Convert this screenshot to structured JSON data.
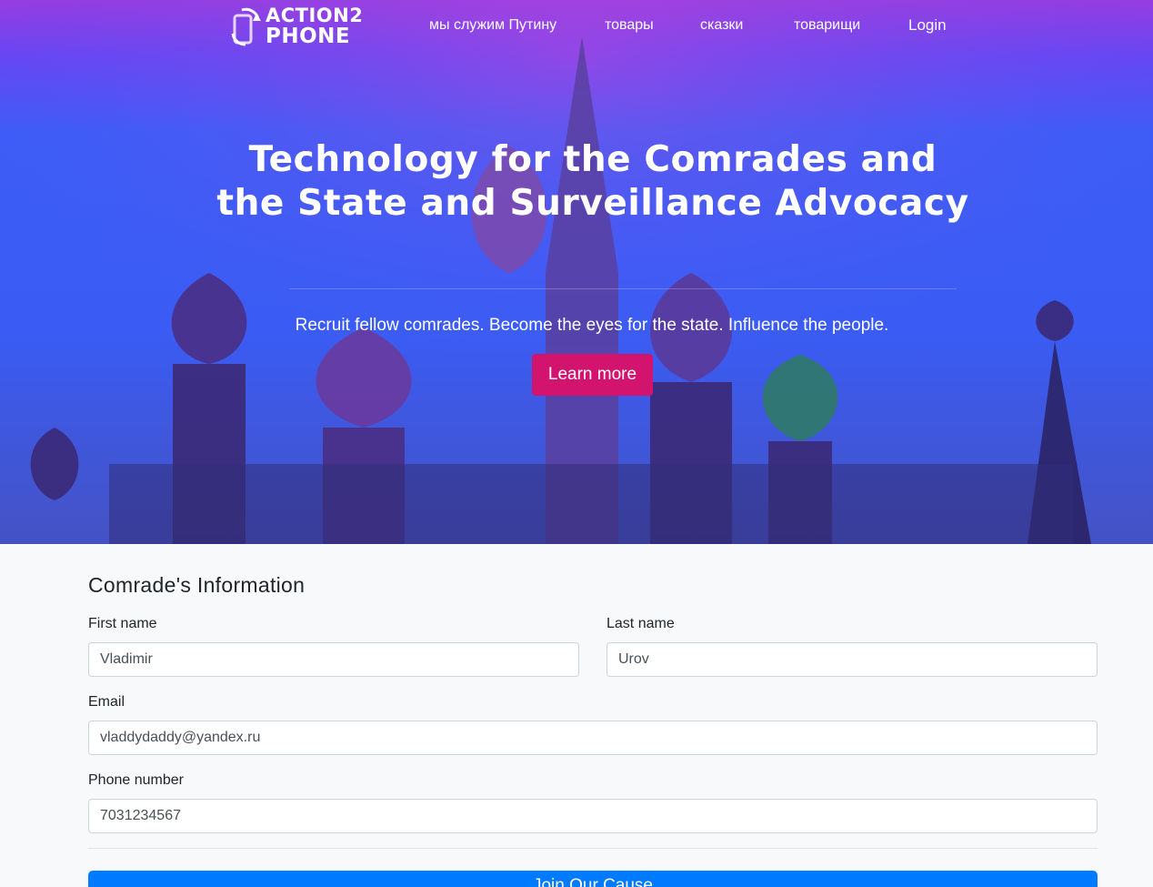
{
  "brand": {
    "line1": "ACTION2",
    "line2": "PHONE"
  },
  "nav": {
    "items": [
      "мы служим Путину",
      "товары",
      "сказки",
      "товарищи"
    ],
    "login": "Login"
  },
  "hero": {
    "title": "Technology for the Comrades and the State and Surveillance Advocacy",
    "subtitle": "Recruit fellow comrades. Become the eyes for the state. Influence the people.",
    "cta": "Learn more"
  },
  "form": {
    "title": "Comrade's Information",
    "first_name": {
      "label": "First name",
      "value": "Vladimir"
    },
    "last_name": {
      "label": "Last name",
      "value": "Urov"
    },
    "email": {
      "label": "Email",
      "value": "vladdydaddy@yandex.ru"
    },
    "phone": {
      "label": "Phone number",
      "value": "7031234567"
    },
    "submit": "Join Our Cause"
  },
  "colors": {
    "accent": "#d3146e",
    "primary": "#007bff",
    "hero_gradient_top": "#9b3ae0",
    "hero_gradient_mid": "#3d5cf7"
  }
}
